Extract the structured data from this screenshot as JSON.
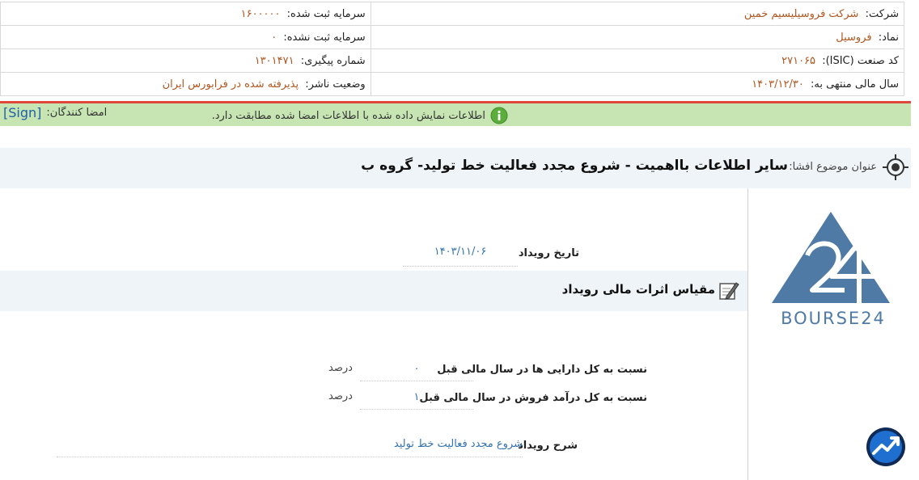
{
  "company_info": {
    "company_label": "شرکت:",
    "company_value": "شرکت فروسیلیسیم خمین",
    "symbol_label": "نماد:",
    "symbol_value": "فروسیل",
    "isic_label": "کد صنعت (ISIC):",
    "isic_value": "۲۷۱۰۶۵",
    "fiscal_year_label": "سال مالی منتهی به:",
    "fiscal_year_value": "۱۴۰۳/۱۲/۳۰",
    "registered_capital_label": "سرمایه ثبت شده:",
    "registered_capital_value": "۱۶۰۰۰۰۰",
    "unregistered_capital_label": "سرمایه ثبت نشده:",
    "unregistered_capital_value": "۰",
    "tracking_label": "شماره پیگیری:",
    "tracking_value": "۱۳۰۱۴۷۱",
    "publisher_status_label": "وضعیت ناشر:",
    "publisher_status_value": "پذیرفته شده در فرابورس ایران"
  },
  "signature_bar": {
    "message": "اطلاعات نمایش داده شده با اطلاعات امضا شده مطابقت دارد.",
    "signers_label": "امضا کنندگان:",
    "sign_link": "[Sign]"
  },
  "subject": {
    "label": "عنوان موضوع افشا:",
    "title": "سایر اطلاعات بااهمیت - شروع مجدد فعالیت خط تولید- گروه ب"
  },
  "event": {
    "date_label": "تاریخ رویداد",
    "date_value": "۱۴۰۳/۱۱/۰۶",
    "description_label": "شرح رویداد",
    "description_value": "شروع مجدد فعالیت خط تولید"
  },
  "financial_section": {
    "title": "مقیاس اثرات مالی رویداد",
    "rows": [
      {
        "label": "نسبت به کل دارایی ها در سال مالی قبل",
        "value": "۰",
        "unit": "درصد"
      },
      {
        "label": "نسبت به کل درآمد فروش در سال مالی قبل",
        "value": "۱",
        "unit": "درصد"
      }
    ]
  },
  "logo": {
    "text": "BOURSE24",
    "color": "#4f7aa6"
  },
  "colors": {
    "value_text": "#b0561f",
    "link_blue": "#3573b0",
    "green_bar": "#c6e5b3",
    "red_line": "#e0473b"
  }
}
